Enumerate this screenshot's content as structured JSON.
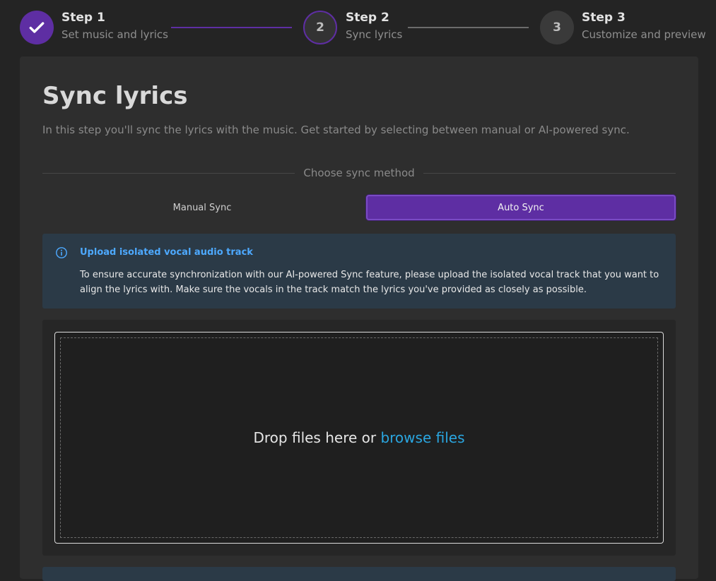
{
  "stepper": {
    "steps": [
      {
        "title": "Step 1",
        "subtitle": "Set music and lyrics",
        "number": "1",
        "state": "completed"
      },
      {
        "title": "Step 2",
        "subtitle": "Sync lyrics",
        "number": "2",
        "state": "active"
      },
      {
        "title": "Step 3",
        "subtitle": "Customize and preview",
        "number": "3",
        "state": "pending"
      }
    ],
    "colors": {
      "accent": "#5e2ea3",
      "pending": "#3a3a3a",
      "line_done": "#5e2ea3",
      "line_pending": "#6b6b6b"
    },
    "completed_icon": "check-icon"
  },
  "page": {
    "title": "Sync lyrics",
    "description": "In this step you'll sync the lyrics with the music. Get started by selecting between manual or AI-powered sync."
  },
  "sync_method": {
    "label": "Choose sync method",
    "options": [
      {
        "label": "Manual Sync",
        "selected": false
      },
      {
        "label": "Auto Sync",
        "selected": true
      }
    ]
  },
  "alert": {
    "icon": "info-icon",
    "title": "Upload isolated vocal audio track",
    "body": "To ensure accurate synchronization with our AI-powered Sync feature, please upload the isolated vocal track that you want to align the lyrics with. Make sure the vocals in the track match the lyrics you've provided as closely as possible."
  },
  "dropzone": {
    "text": "Drop files here or ",
    "link": "browse files"
  }
}
